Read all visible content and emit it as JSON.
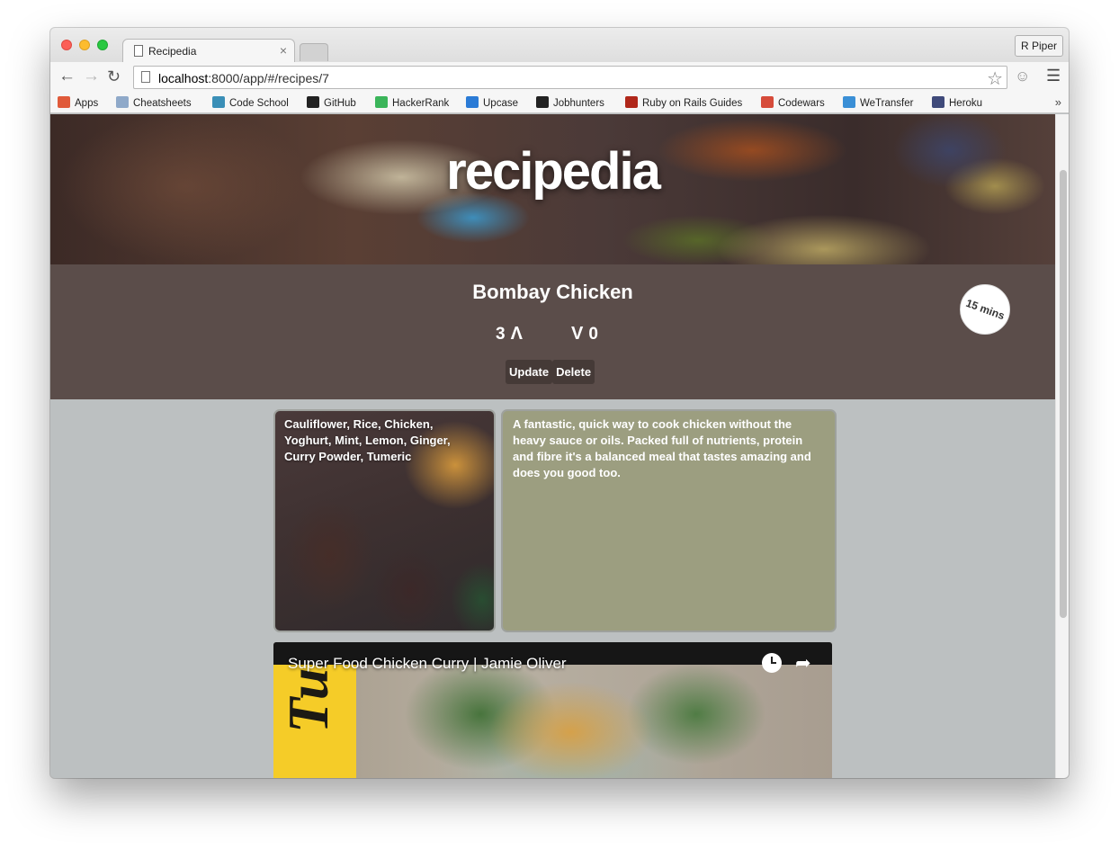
{
  "browser": {
    "tab_title": "Recipedia",
    "tab_close": "×",
    "profile_name": "R Piper",
    "url_host": "localhost",
    "url_rest": ":8000/app/#/recipes/7",
    "bookmarks": [
      {
        "label": "Apps",
        "icon": "apps-grid-icon",
        "color": "#e05a3a"
      },
      {
        "label": "Cheatsheets",
        "icon": "folder-icon",
        "color": "#8fa9c9"
      },
      {
        "label": "Code School",
        "icon": "code-school-icon",
        "color": "#3a8fb7"
      },
      {
        "label": "GitHub",
        "icon": "github-icon",
        "color": "#222222"
      },
      {
        "label": "HackerRank",
        "icon": "hackerrank-icon",
        "color": "#3bb55a"
      },
      {
        "label": "Upcase",
        "icon": "upcase-icon",
        "color": "#2b7bd6"
      },
      {
        "label": "Jobhunters",
        "icon": "github-icon",
        "color": "#222222"
      },
      {
        "label": "Ruby on Rails Guides",
        "icon": "rails-icon",
        "color": "#b0271a"
      },
      {
        "label": "Codewars",
        "icon": "codewars-icon",
        "color": "#d64b3a"
      },
      {
        "label": "WeTransfer",
        "icon": "wetransfer-icon",
        "color": "#3a8fd6"
      },
      {
        "label": "Heroku",
        "icon": "heroku-icon",
        "color": "#3f4a7a"
      }
    ],
    "bookmarks_more": "»"
  },
  "page": {
    "brand": "recipedia",
    "recipe_title": "Bombay Chicken",
    "upvotes": "3",
    "downvotes": "0",
    "update_label": "Update",
    "delete_label": "Delete",
    "cook_time": "15 mins",
    "ingredients": "Cauliflower, Rice, Chicken, Yoghurt, Mint, Lemon, Ginger, Curry Powder, Tumeric",
    "description": "A fantastic, quick way to cook chicken without the heavy sauce or oils. Packed full of nutrients, protein and fibre it's a balanced meal that tastes amazing and does you good too.",
    "video_title": "Super Food Chicken Curry | Jamie Oliver",
    "video_side_text": "Tube"
  }
}
